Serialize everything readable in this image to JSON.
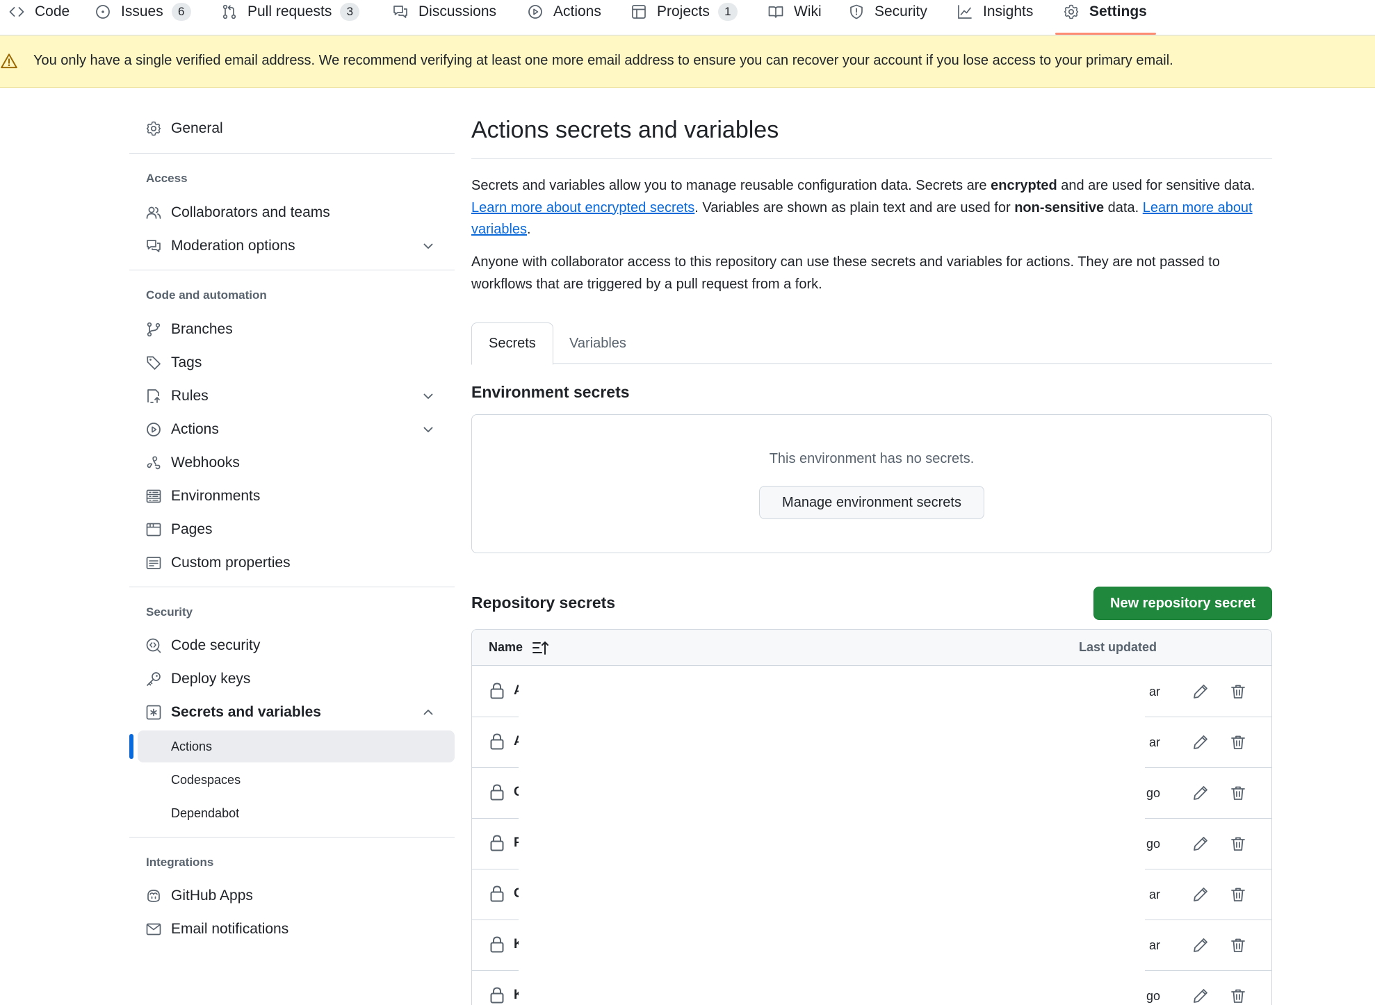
{
  "repo_nav": {
    "tabs": [
      {
        "label": "Code",
        "icon": "code-icon"
      },
      {
        "label": "Issues",
        "icon": "issue-opened-icon",
        "count": "6"
      },
      {
        "label": "Pull requests",
        "icon": "git-pull-request-icon",
        "count": "3"
      },
      {
        "label": "Discussions",
        "icon": "comment-discussion-icon"
      },
      {
        "label": "Actions",
        "icon": "play-icon"
      },
      {
        "label": "Projects",
        "icon": "table-icon",
        "count": "1"
      },
      {
        "label": "Wiki",
        "icon": "book-icon"
      },
      {
        "label": "Security",
        "icon": "shield-icon"
      },
      {
        "label": "Insights",
        "icon": "graph-icon"
      },
      {
        "label": "Settings",
        "icon": "gear-icon",
        "selected": true
      }
    ],
    "underline_color": "#fd8c73"
  },
  "banner": {
    "message": "You only have a single verified email address. We recommend verifying at least one more email address to ensure you can recover your account if you lose access to your primary email.",
    "icon": "alert-icon",
    "bg_color": "#fff8c5"
  },
  "sidebar": {
    "general": "General",
    "sections": {
      "access": {
        "heading": "Access",
        "items": [
          "Collaborators and teams",
          "Moderation options"
        ]
      },
      "code_automation": {
        "heading": "Code and automation",
        "items": [
          "Branches",
          "Tags",
          "Rules",
          "Actions",
          "Webhooks",
          "Environments",
          "Pages",
          "Custom properties"
        ]
      },
      "security": {
        "heading": "Security",
        "items": [
          "Code security",
          "Deploy keys",
          "Secrets and variables"
        ],
        "subitems": [
          "Actions",
          "Codespaces",
          "Dependabot"
        ]
      },
      "integrations": {
        "heading": "Integrations",
        "items": [
          "GitHub Apps",
          "Email notifications"
        ]
      }
    },
    "active_color": "#0969da"
  },
  "main": {
    "title": "Actions secrets and variables",
    "intro": {
      "t1": "Secrets and variables allow you to manage reusable configuration data. Secrets are ",
      "b1": "encrypted",
      "t2": " and are used for sensitive data. ",
      "link1": "Learn more about encrypted secrets",
      "t3": ". Variables are shown as plain text and are used for ",
      "b2": "non-sensitive",
      "t4": " data. ",
      "link2": "Learn more about variables",
      "t5": "."
    },
    "access_note": "Anyone with collaborator access to this repository can use these secrets and variables for actions. They are not passed to workflows that are triggered by a pull request from a fork.",
    "tabs": [
      "Secrets",
      "Variables"
    ],
    "env_secrets": {
      "heading": "Environment secrets",
      "empty": "This environment has no secrets.",
      "button": "Manage environment secrets"
    },
    "repo_secrets": {
      "heading": "Repository secrets",
      "new_button": "New repository secret",
      "primary_color": "#1f883d",
      "columns": {
        "name": "Name",
        "updated": "Last updated"
      },
      "rows": [
        {
          "name": "A",
          "updated": "ar"
        },
        {
          "name": "A",
          "updated": "ar"
        },
        {
          "name": "C",
          "updated": "go"
        },
        {
          "name": "F",
          "updated": "go"
        },
        {
          "name": "C",
          "updated": "ar"
        },
        {
          "name": "K",
          "updated": "ar"
        },
        {
          "name": "K",
          "updated": "go"
        }
      ]
    }
  }
}
